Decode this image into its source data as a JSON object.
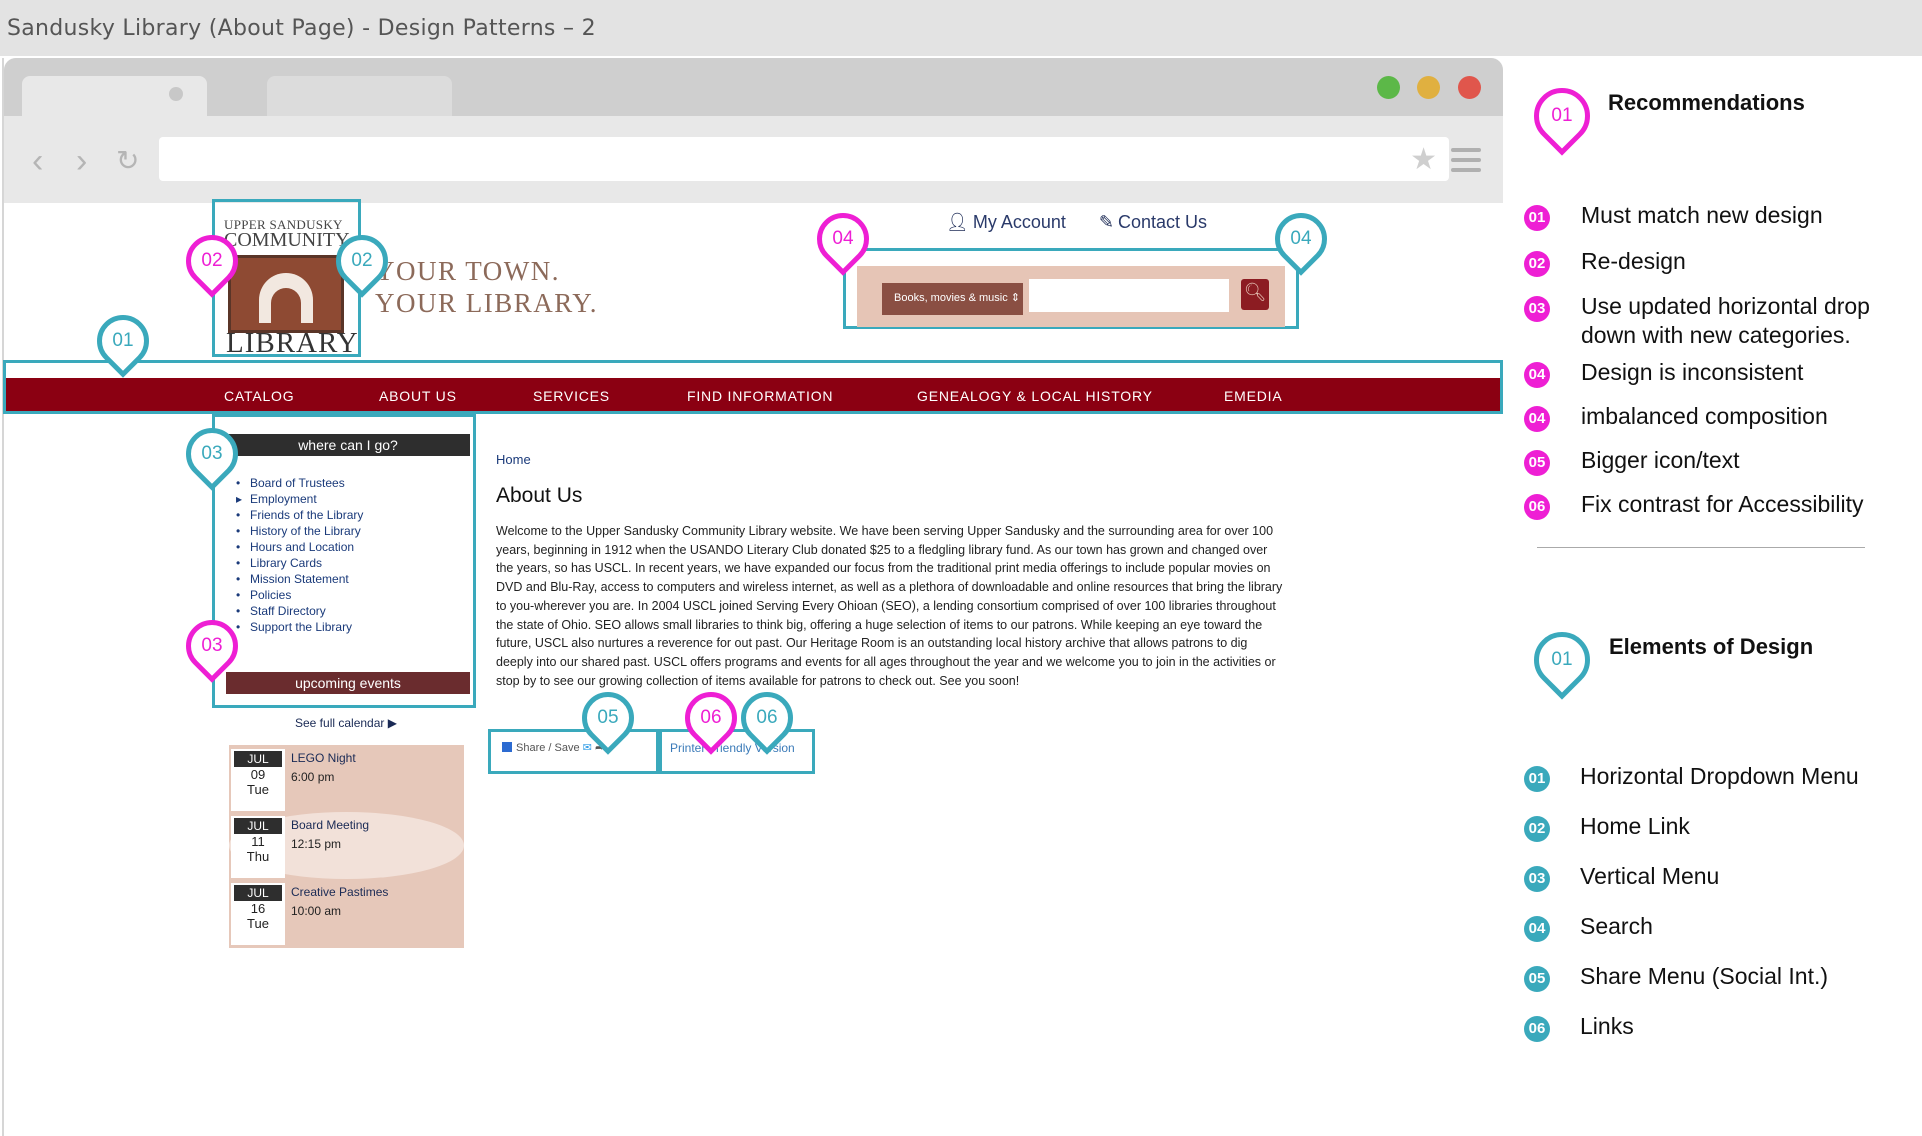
{
  "window": {
    "title": "Sandusky Library (About Page) - Design Patterns – 2"
  },
  "browser": {
    "back_icon": "chevron-left-icon",
    "forward_icon": "chevron-right-icon",
    "reload_icon": "reload-icon",
    "bookmark_icon": "star-icon",
    "menu_icon": "hamburger-icon"
  },
  "site": {
    "logo": {
      "line1": "UPPER SANDUSKY",
      "line2": "COMMUNITY",
      "line3": "LIBRARY"
    },
    "tagline": {
      "line1": "YOUR TOWN.",
      "line2": "YOUR LIBRARY."
    },
    "account_link": "My Account",
    "contact_link": "Contact Us",
    "search": {
      "category": "Books, movies & music ⇕",
      "value": "",
      "button_icon": "search-icon"
    },
    "nav": [
      "CATALOG",
      "ABOUT US",
      "SERVICES",
      "FIND INFORMATION",
      "GENEALOGY & LOCAL HISTORY",
      "EMEDIA"
    ],
    "sidebar": {
      "heading": "where can I go?",
      "items": [
        "Board of Trustees",
        "Employment",
        "Friends of the Library",
        "History of the Library",
        "Hours and Location",
        "Library Cards",
        "Mission Statement",
        "Policies",
        "Staff Directory",
        "Support the Library"
      ],
      "footer": "upcoming events",
      "calendar_link": "See full calendar ▶"
    },
    "events": [
      {
        "month": "JUL",
        "day": "09",
        "weekday": "Tue",
        "title": "LEGO Night",
        "time": "6:00 pm"
      },
      {
        "month": "JUL",
        "day": "11",
        "weekday": "Thu",
        "title": "Board Meeting",
        "time": "12:15 pm"
      },
      {
        "month": "JUL",
        "day": "16",
        "weekday": "Tue",
        "title": "Creative Pastimes",
        "time": "10:00 am"
      }
    ],
    "breadcrumb": "Home",
    "page_title": "About Us",
    "body": "Welcome to the Upper Sandusky Community Library website. We have been serving Upper Sandusky and the surrounding area for over 100 years, beginning in 1912 when the USANDO Literary Club donated $25 to a fledgling library fund. As our town has grown and changed over the years, so has USCL. In recent years, we have expanded our focus from the traditional print media offerings to include popular movies on DVD and Blu-Ray, access to computers and wireless internet, as well as a plethora of downloadable and online resources that bring the library to you-wherever you are. In 2004 USCL joined Serving Every Ohioan (SEO), a lending consortium comprised of over 100 libraries throughout the state of Ohio. SEO allows small libraries to think big, offering a huge selection of items to our patrons. While keeping an eye toward the future, USCL also nurtures a reverence for out past. Our Heritage Room is an outstanding local history archive that allows patrons to dig deeply into our shared past. USCL offers programs and events for all ages throughout the year and we welcome you to join in the activities or stop by to see our growing collection of items available for patrons to check out. See you soon!",
    "share_label": "Share / Save",
    "print_link": "Printer Friendly Version"
  },
  "markers": {
    "nav": "01",
    "logo_pink": "02",
    "logo_teal": "02",
    "sidebar_top": "03",
    "sidebar_bottom": "03",
    "search_left": "04",
    "search_right": "04",
    "share": "05",
    "print_pink": "06",
    "print_teal": "06"
  },
  "panel": {
    "recommendations_marker": "01",
    "recommendations_title": "Recommendations",
    "recommendations": [
      {
        "num": "01",
        "text": "Must match new design"
      },
      {
        "num": "02",
        "text": "Re-design"
      },
      {
        "num": "03",
        "text": "Use updated horizontal drop down with new categories."
      },
      {
        "num": "04",
        "text": "Design is inconsistent"
      },
      {
        "num": "04",
        "text": "imbalanced composition"
      },
      {
        "num": "05",
        "text": "Bigger icon/text"
      },
      {
        "num": "06",
        "text": "Fix contrast for Accessibility"
      }
    ],
    "elements_marker": "01",
    "elements_title": "Elements of Design",
    "elements": [
      {
        "num": "01",
        "text": "Horizontal Dropdown Menu"
      },
      {
        "num": "02",
        "text": "Home Link"
      },
      {
        "num": "03",
        "text": "Vertical Menu"
      },
      {
        "num": "04",
        "text": "Search"
      },
      {
        "num": "05",
        "text": "Share Menu (Social Int.)"
      },
      {
        "num": "06",
        "text": "Links"
      }
    ]
  },
  "colors": {
    "annotation_teal": "#3aa9bc",
    "annotation_pink": "#ee1fd4",
    "nav_red": "#8b0012",
    "link_blue": "#1a3a7a"
  }
}
